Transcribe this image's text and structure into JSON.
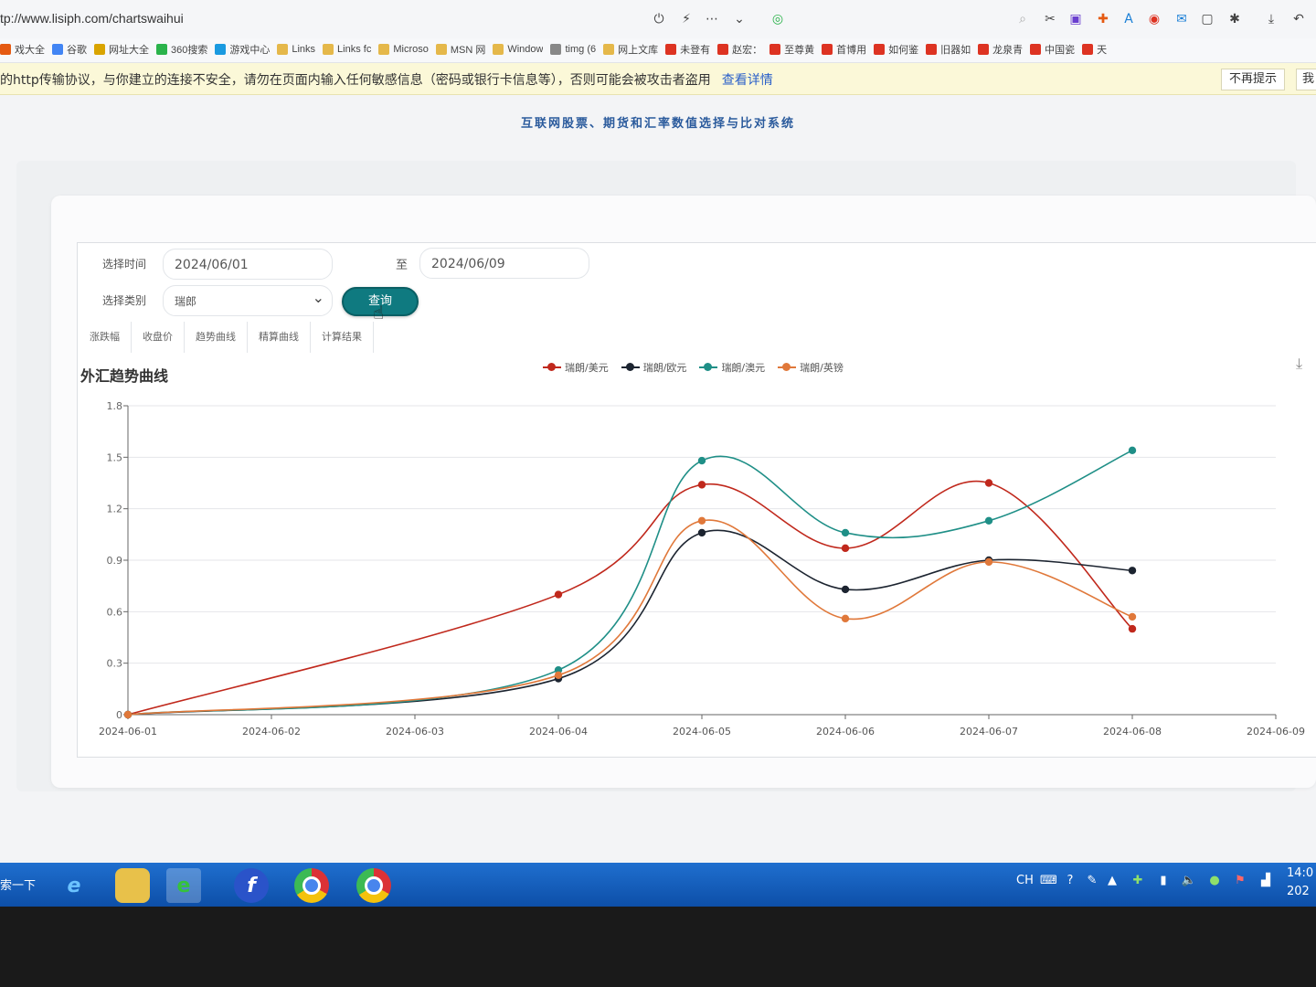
{
  "browser": {
    "url": "tp://www.lisiph.com/chartswaihui",
    "bookmarks": [
      "戏大全",
      "谷歌",
      "网址大全",
      "360搜索",
      "游戏中心",
      "Links",
      "Links fc",
      "Microso",
      "MSN 网",
      "Window",
      "timg (6",
      "网上文库",
      "未登有",
      "赵宏：",
      "至尊黄",
      "首博用",
      "如何鉴",
      "旧器如",
      "龙泉青",
      "中国瓷",
      "天"
    ]
  },
  "security_bar": {
    "text": "的http传输协议，与你建立的连接不安全，请勿在页面内输入任何敏感信息（密码或银行卡信息等），否则可能会被攻击者盗用",
    "link": "查看详情",
    "dismiss": "不再提示",
    "more": "我"
  },
  "page": {
    "title": "互联网股票、期货和汇率数值选择与比对系统"
  },
  "form": {
    "time_label": "选择时间",
    "start_date": "2024/06/01",
    "to_label": "至",
    "end_date": "2024/06/09",
    "type_label": "选择类别",
    "type_value": "瑞郎",
    "query_button": "查询"
  },
  "tabs": [
    "涨跌幅",
    "收盘价",
    "趋势曲线",
    "精算曲线",
    "计算结果"
  ],
  "chart_data": {
    "type": "line",
    "title": "外汇趋势曲线",
    "x": [
      "2024-06-01",
      "2024-06-02",
      "2024-06-03",
      "2024-06-04",
      "2024-06-05",
      "2024-06-06",
      "2024-06-07",
      "2024-06-08",
      "2024-06-09"
    ],
    "point_dates": [
      "2024-06-01",
      "2024-06-04",
      "2024-06-05",
      "2024-06-06",
      "2024-06-07",
      "2024-06-08"
    ],
    "yticks": [
      "0",
      "0.3",
      "0.6",
      "0.9",
      "1.2",
      "1.5",
      "1.8"
    ],
    "ylim": [
      0,
      1.8
    ],
    "grid": true,
    "legend_position": "top-center",
    "series": [
      {
        "name": "瑞朗/美元",
        "color": "#c0281c",
        "values": [
          0,
          0.7,
          1.34,
          0.97,
          1.35,
          0.5
        ]
      },
      {
        "name": "瑞朗/欧元",
        "color": "#1c2430",
        "values": [
          0,
          0.21,
          1.06,
          0.73,
          0.9,
          0.84
        ]
      },
      {
        "name": "瑞朗/澳元",
        "color": "#1f8f87",
        "values": [
          0,
          0.26,
          1.48,
          1.06,
          1.13,
          1.54
        ]
      },
      {
        "name": "瑞朗/英镑",
        "color": "#e0783a",
        "values": [
          0,
          0.23,
          1.13,
          0.56,
          0.89,
          0.57
        ]
      }
    ]
  },
  "taskbar": {
    "start_label": "索一下",
    "apps": [
      "ie-icon",
      "folder-icon",
      "ie-browser-icon",
      "flash-icon",
      "chrome-icon",
      "chrome-icon"
    ],
    "lang": "CH",
    "time": "14:0",
    "date": "202"
  }
}
